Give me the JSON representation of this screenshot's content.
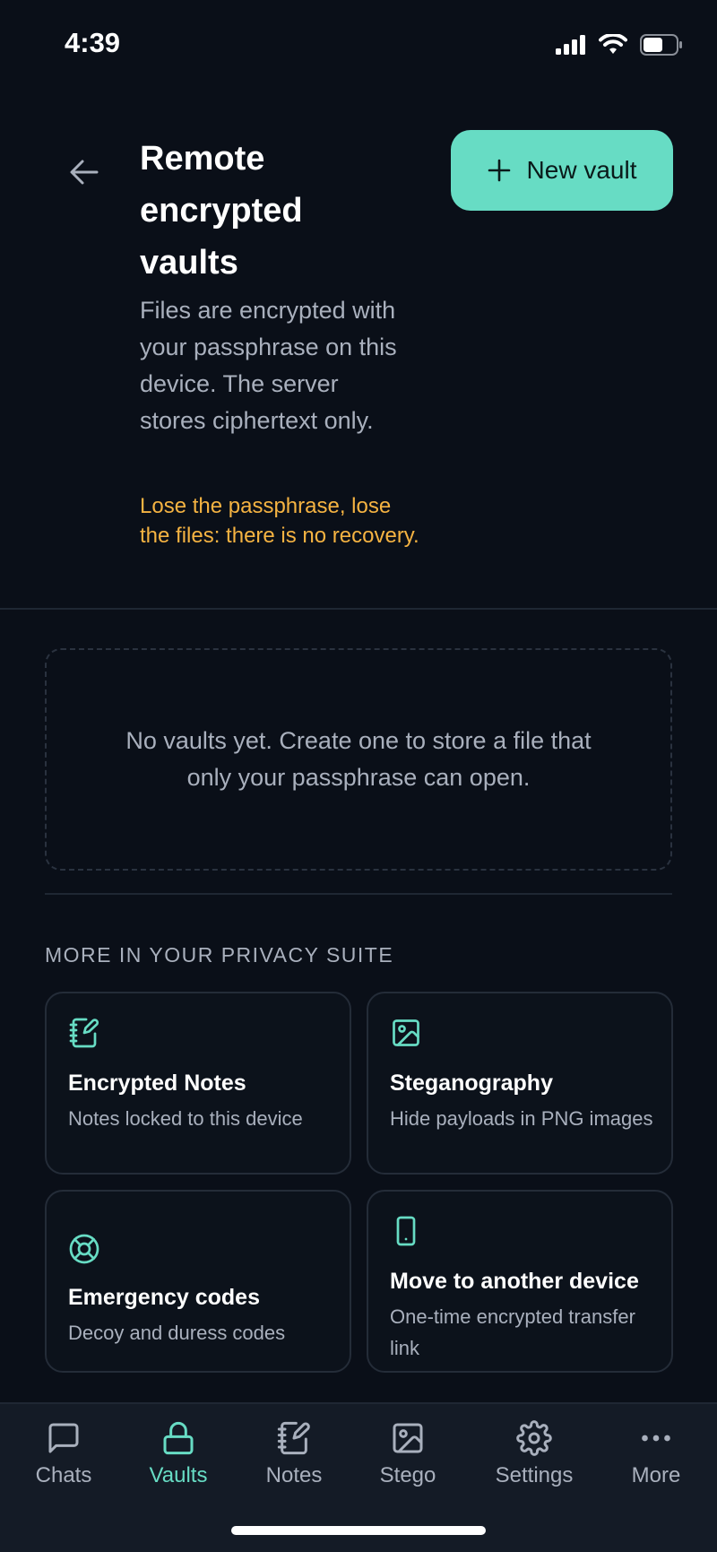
{
  "status_bar": {
    "time": "4:39"
  },
  "header": {
    "title": "Remote encrypted vaults",
    "new_vault_label": "New vault",
    "subtitle": "Files are encrypted with your passphrase on this device. The server stores ciphertext only.",
    "warning": "Lose the passphrase, lose the files: there is no recovery."
  },
  "empty_state": {
    "text": "No vaults yet. Create one to store a file that only your passphrase can open."
  },
  "suite": {
    "heading": "MORE IN YOUR PRIVACY SUITE",
    "cards": [
      {
        "icon": "notebook-edit-icon",
        "title": "Encrypted Notes",
        "desc": "Notes locked to this device"
      },
      {
        "icon": "image-icon",
        "title": "Steganography",
        "desc": "Hide payloads in PNG images"
      },
      {
        "icon": "lifebuoy-icon",
        "title": "Emergency codes",
        "desc": "Decoy and duress codes"
      },
      {
        "icon": "smartphone-icon",
        "title": "Move to another device",
        "desc": "One-time encrypted transfer link"
      }
    ]
  },
  "nav": {
    "items": [
      {
        "label": "Chats",
        "icon": "chat-bubble-icon"
      },
      {
        "label": "Vaults",
        "icon": "lock-icon",
        "active": true
      },
      {
        "label": "Notes",
        "icon": "notebook-edit-icon"
      },
      {
        "label": "Stego",
        "icon": "image-icon"
      },
      {
        "label": "Settings",
        "icon": "gear-icon"
      },
      {
        "label": "More",
        "icon": "more-dots-icon"
      }
    ]
  },
  "colors": {
    "background": "#0a0f18",
    "accent": "#67dcc4",
    "warning": "#f5b342",
    "muted_text": "#a9b0bd",
    "nav_background": "#141b26"
  }
}
